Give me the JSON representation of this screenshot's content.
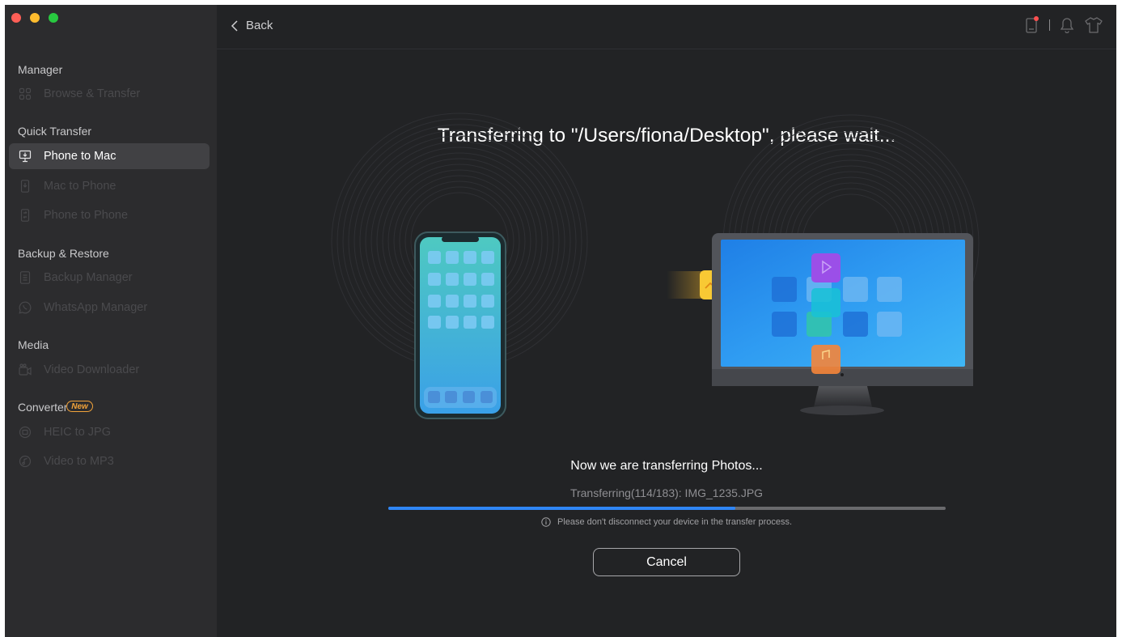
{
  "sidebar": {
    "sections": {
      "manager": "Manager",
      "quick_transfer": "Quick Transfer",
      "backup_restore": "Backup & Restore",
      "media": "Media",
      "converter": "Converter"
    },
    "new_badge": "New",
    "items": {
      "browse_transfer": "Browse & Transfer",
      "phone_to_mac": "Phone to Mac",
      "mac_to_phone": "Mac to Phone",
      "phone_to_phone": "Phone to Phone",
      "backup_manager": "Backup Manager",
      "whatsapp_manager": "WhatsApp Manager",
      "video_downloader": "Video Downloader",
      "heic_to_jpg": "HEIC to JPG",
      "video_to_mp3": "Video to MP3"
    },
    "active_item": "phone_to_mac"
  },
  "topbar": {
    "back_label": "Back",
    "icons": [
      "device-icon",
      "bell-icon",
      "shirt-icon"
    ]
  },
  "main": {
    "title": "Transferring to \"/Users/fiona/Desktop\", please wait...",
    "status": "Now we are transferring Photos...",
    "substatus": "Transferring(114/183): IMG_1235.JPG",
    "progress": {
      "current": 114,
      "total": 183
    },
    "warning": "Please don't disconnect your device in the transfer process.",
    "cancel_label": "Cancel"
  },
  "colors": {
    "accent": "#2f86f6",
    "badge": "#f2a33a",
    "background": "#222325",
    "sidebar": "#2c2c2e"
  }
}
